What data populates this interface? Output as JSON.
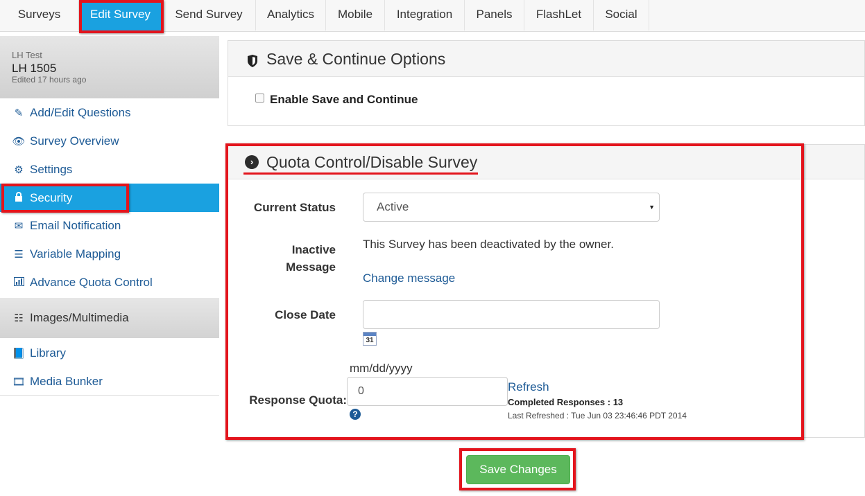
{
  "nav": {
    "tabs": [
      "Surveys",
      "Edit Survey",
      "Send Survey",
      "Analytics",
      "Mobile",
      "Integration",
      "Panels",
      "FlashLet",
      "Social"
    ],
    "active_tab": "Edit Survey"
  },
  "sidebar": {
    "survey_group": "LH Test",
    "survey_name": "LH 1505",
    "edited": "Edited 17 hours ago",
    "items": [
      {
        "label": "Add/Edit Questions",
        "icon": "edit-icon"
      },
      {
        "label": "Survey Overview",
        "icon": "eye-icon"
      },
      {
        "label": "Settings",
        "icon": "gears-icon"
      },
      {
        "label": "Security",
        "icon": "lock-icon"
      },
      {
        "label": "Email Notification",
        "icon": "envelope-icon"
      },
      {
        "label": "Variable Mapping",
        "icon": "list-icon"
      },
      {
        "label": "Advance Quota Control",
        "icon": "bar-chart-icon"
      }
    ],
    "section": {
      "label": "Images/Multimedia",
      "icon": "list-bullets-icon"
    },
    "section_items": [
      {
        "label": "Library",
        "icon": "book-icon"
      },
      {
        "label": "Media Bunker",
        "icon": "film-icon"
      }
    ]
  },
  "save_continue": {
    "title": "Save & Continue Options",
    "checkbox_label": "Enable Save and Continue",
    "checked": false
  },
  "quota": {
    "title": "Quota Control/Disable Survey",
    "current_status_label": "Current Status",
    "current_status_value": "Active",
    "inactive_message_label_1": "Inactive",
    "inactive_message_label_2": "Message",
    "inactive_message": "This Survey has been deactivated by the owner.",
    "change_message": "Change message",
    "close_date_label": "Close Date",
    "close_date_value": "",
    "calendar_day": "31",
    "date_format": "mm/dd/yyyy",
    "response_quota_label": "Response Quota:",
    "response_quota_value": "0",
    "help": "?",
    "refresh": "Refresh",
    "completed_responses": "Completed Responses : 13",
    "last_refreshed": "Last Refreshed : Tue Jun 03 23:46:46 PDT 2014"
  },
  "save_button": "Save Changes",
  "colors": {
    "accent": "#1aa1e0",
    "link": "#1e5b96",
    "highlight": "#e3141c",
    "save": "#5cb85c"
  }
}
